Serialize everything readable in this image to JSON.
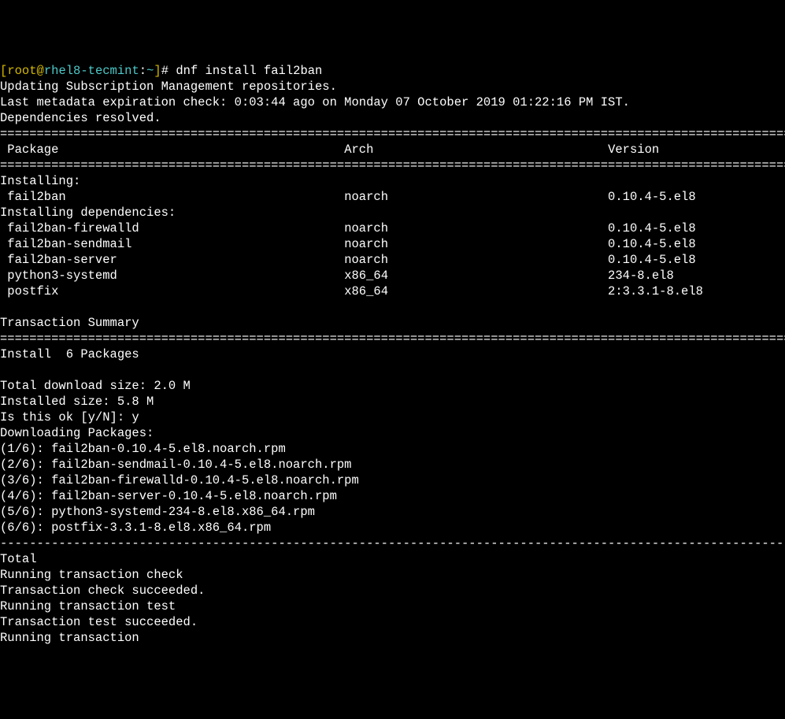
{
  "prompt": {
    "open": "[",
    "user": "root",
    "at": "@",
    "host": "rhel8-tecmint",
    "colon": ":",
    "path": "~",
    "close": "]",
    "hash": "# ",
    "command": "dnf install fail2ban"
  },
  "header_lines": {
    "l1": "Updating Subscription Management repositories.",
    "l2": "Last metadata expiration check: 0:03:44 ago on Monday 07 October 2019 01:22:16 PM IST.",
    "l3": "Dependencies resolved."
  },
  "separator": "================================================================================================================",
  "table_header": {
    "col1": " Package",
    "col2": "Arch",
    "col3": "Version"
  },
  "installing_label": "Installing:",
  "installing_deps_label": "Installing dependencies:",
  "packages": [
    {
      "name": " fail2ban",
      "arch": "noarch",
      "version": "0.10.4-5.el8"
    }
  ],
  "deps": [
    {
      "name": " fail2ban-firewalld",
      "arch": "noarch",
      "version": "0.10.4-5.el8"
    },
    {
      "name": " fail2ban-sendmail",
      "arch": "noarch",
      "version": "0.10.4-5.el8"
    },
    {
      "name": " fail2ban-server",
      "arch": "noarch",
      "version": "0.10.4-5.el8"
    },
    {
      "name": " python3-systemd",
      "arch": "x86_64",
      "version": "234-8.el8"
    },
    {
      "name": " postfix",
      "arch": "x86_64",
      "version": "2:3.3.1-8.el8"
    }
  ],
  "transaction": {
    "summary": "Transaction Summary",
    "install_line": "Install  6 Packages",
    "download_size": "Total download size: 2.0 M",
    "installed_size": "Installed size: 5.8 M",
    "confirm": "Is this ok [y/N]: y",
    "downloading": "Downloading Packages:"
  },
  "downloads": [
    "(1/6): fail2ban-0.10.4-5.el8.noarch.rpm",
    "(2/6): fail2ban-sendmail-0.10.4-5.el8.noarch.rpm",
    "(3/6): fail2ban-firewalld-0.10.4-5.el8.noarch.rpm",
    "(4/6): fail2ban-server-0.10.4-5.el8.noarch.rpm",
    "(5/6): python3-systemd-234-8.el8.x86_64.rpm",
    "(6/6): postfix-3.3.1-8.el8.x86_64.rpm"
  ],
  "dash_line": "----------------------------------------------------------------------------------------------------------------",
  "footer": {
    "total": "Total",
    "l1": "Running transaction check",
    "l2": "Transaction check succeeded.",
    "l3": "Running transaction test",
    "l4": "Transaction test succeeded.",
    "l5": "Running transaction"
  }
}
